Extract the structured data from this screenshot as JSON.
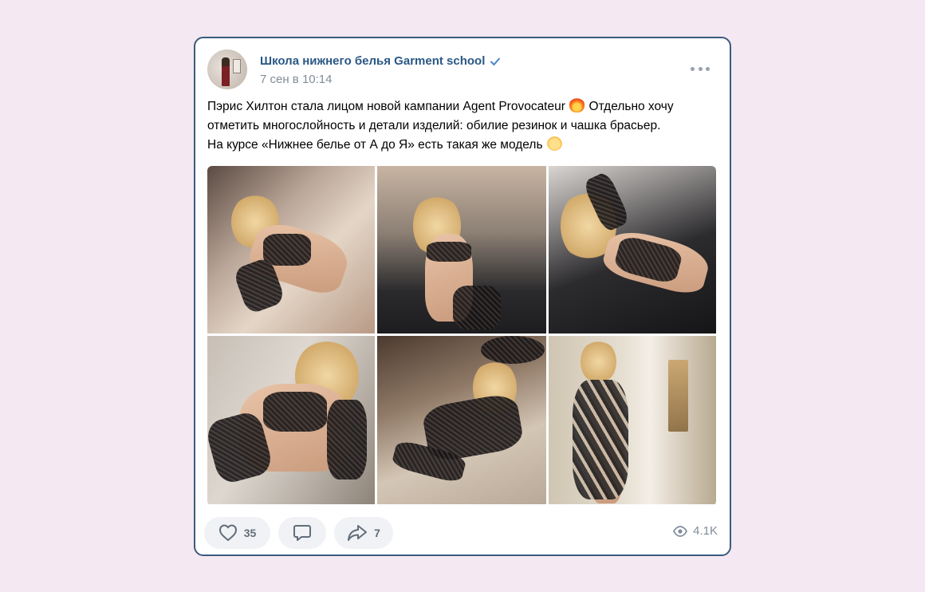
{
  "post": {
    "author": "Школа нижнего белья Garment school",
    "date": "7 сен в 10:14",
    "text_lines": [
      "Пэрис Хилтон стала лицом новой кампании Agent Provocateur",
      "Отдельно хочу",
      "отметить многослойность и детали изделий: обилие резинок и чашка брасьер.",
      "На курсе «Нижнее белье от А до Я» есть такая же модель"
    ],
    "emoji": [
      "fire-emoji",
      "raised-hands-emoji"
    ],
    "photos_count": 6
  },
  "actions": {
    "likes": "35",
    "shares": "7",
    "views": "4.1K"
  },
  "colors": {
    "background": "#f4e8f2",
    "author": "#2a5885",
    "meta": "#818c99",
    "action_bg": "#f0f2f5",
    "card_border": "#3b5a7e"
  },
  "icons": {
    "verified": "verified-check-icon",
    "more": "more-dots-icon",
    "like": "heart-icon",
    "comment": "comment-bubble-icon",
    "share": "share-arrow-icon",
    "views": "eye-icon"
  }
}
